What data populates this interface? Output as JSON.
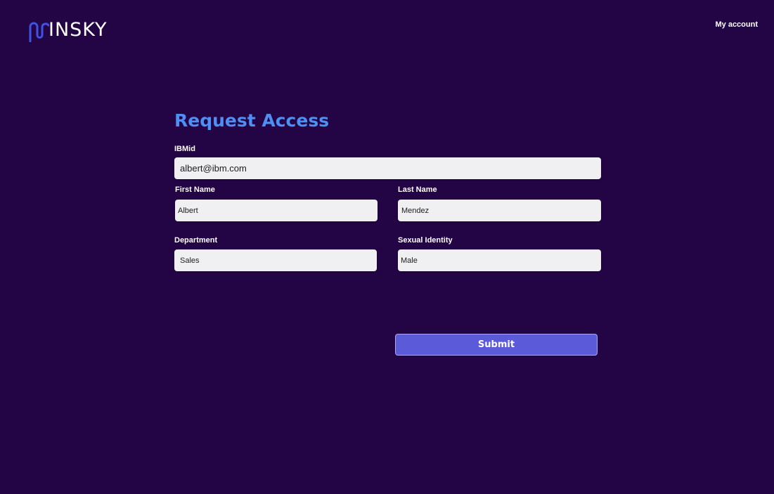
{
  "header": {
    "logo_text": "INSKY",
    "account_link": "My account"
  },
  "form": {
    "title": "Request Access",
    "ibmid": {
      "label": "IBMid",
      "value": "albert@ibm.com"
    },
    "first_name": {
      "label": "First Name",
      "value": "Albert"
    },
    "last_name": {
      "label": "Last Name",
      "value": "Mendez"
    },
    "department": {
      "label": "Department",
      "value": "Sales"
    },
    "sexual_identity": {
      "label": "Sexual Identity",
      "value": "Male"
    },
    "submit_label": "Submit"
  },
  "colors": {
    "background": "#230545",
    "title_accent": "#4d8ff2",
    "logo_mark": "#3f52e6",
    "submit_button": "#5b5bd9",
    "input_background": "#f0f0f3"
  },
  "icons": {
    "logo": "minsky-logo-mark"
  }
}
